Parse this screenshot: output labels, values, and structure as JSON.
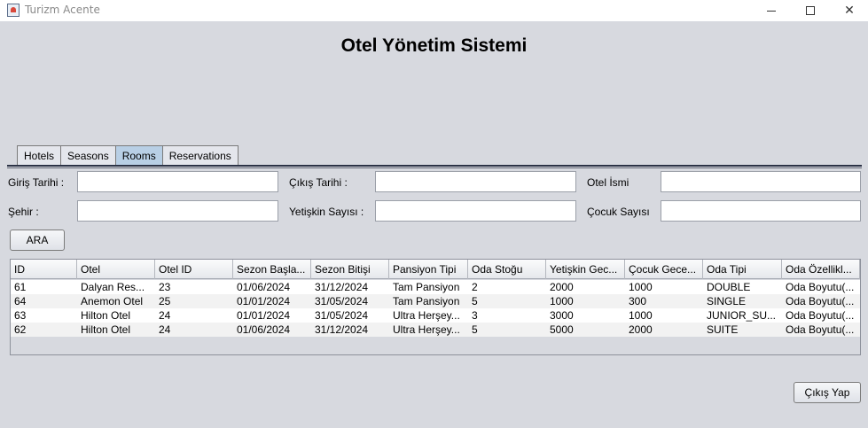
{
  "window": {
    "title": "Turizm Acente",
    "minimize": "",
    "maximize": "",
    "close": "✕"
  },
  "page_title": "Otel Yönetim Sistemi",
  "tabs": [
    {
      "label": "Hotels",
      "active": false
    },
    {
      "label": "Seasons",
      "active": false
    },
    {
      "label": "Rooms",
      "active": true
    },
    {
      "label": "Reservations",
      "active": false
    }
  ],
  "filters": {
    "checkin_label": "Giriş Tarihi :",
    "checkin_value": "",
    "checkout_label": "Çıkış Tarihi :",
    "checkout_value": "",
    "hotel_name_label": "Otel İsmi",
    "hotel_name_value": "",
    "city_label": "Şehir :",
    "city_value": "",
    "adult_label": "Yetişkin Sayısı :",
    "adult_value": "",
    "child_label": "Çocuk Sayısı",
    "child_value": ""
  },
  "search_button": "ARA",
  "logout_button": "Çıkış Yap",
  "table": {
    "columns": [
      "ID",
      "Otel",
      "Otel ID",
      "Sezon Başla...",
      "Sezon Bitişi",
      "Pansiyon Tipi",
      "Oda Stoğu",
      "Yetişkin Gec...",
      "Çocuk Gece...",
      "Oda Tipi",
      "Oda Özellikl..."
    ],
    "rows": [
      [
        "61",
        "Dalyan Res...",
        "23",
        "01/06/2024",
        "31/12/2024",
        "Tam Pansiyon",
        "2",
        "2000",
        "1000",
        "DOUBLE",
        "Oda Boyutu(..."
      ],
      [
        "64",
        "Anemon Otel",
        "25",
        "01/01/2024",
        "31/05/2024",
        "Tam Pansiyon",
        "5",
        "1000",
        "300",
        "SINGLE",
        "Oda Boyutu(..."
      ],
      [
        "63",
        "Hilton Otel",
        "24",
        "01/01/2024",
        "31/05/2024",
        "Ultra Herşey...",
        "3",
        "3000",
        "1000",
        "JUNIOR_SU...",
        "Oda Boyutu(..."
      ],
      [
        "62",
        "Hilton Otel",
        "24",
        "01/06/2024",
        "31/12/2024",
        "Ultra Herşey...",
        "5",
        "5000",
        "2000",
        "SUITE",
        "Oda Boyutu(..."
      ]
    ]
  }
}
